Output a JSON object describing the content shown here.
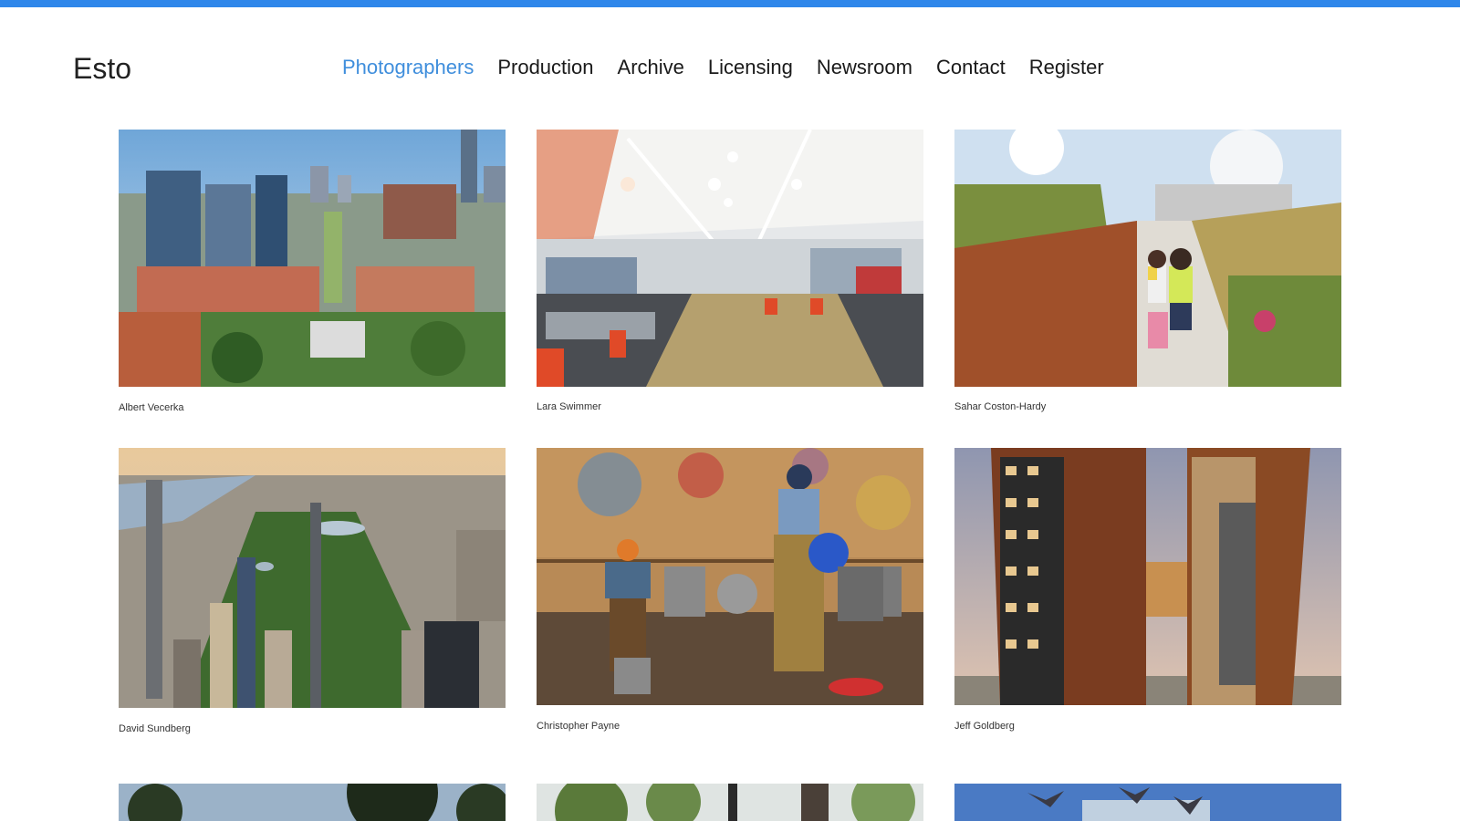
{
  "brand": {
    "logo_text": "Esto",
    "accent": "#2f87ea",
    "active_nav_color": "#3f8edc"
  },
  "nav": [
    {
      "label": "Photographers",
      "active": true
    },
    {
      "label": "Production",
      "active": false
    },
    {
      "label": "Archive",
      "active": false
    },
    {
      "label": "Licensing",
      "active": false
    },
    {
      "label": "Newsroom",
      "active": false
    },
    {
      "label": "Contact",
      "active": false
    },
    {
      "label": "Register",
      "active": false
    }
  ],
  "photographers": [
    {
      "name": "Albert Vecerka",
      "photo": "aerial-university-campus-with-downtown-skyline"
    },
    {
      "name": "Lara Swimmer",
      "photo": "library-interior-children-area"
    },
    {
      "name": "Sahar Coston-Hardy",
      "photo": "rooftop-garden-path-with-children"
    },
    {
      "name": "David Sundberg",
      "photo": "aerial-central-park-manhattan"
    },
    {
      "name": "Christopher Payne",
      "photo": "paint-workshop-two-workers"
    },
    {
      "name": "Jeff Goldberg",
      "photo": "twin-copper-towers-with-skybridge"
    },
    {
      "name": "",
      "photo": "trees-and-sky"
    },
    {
      "name": "",
      "photo": "green-trees-park"
    },
    {
      "name": "",
      "photo": "building-with-birds-blue-sky"
    }
  ]
}
